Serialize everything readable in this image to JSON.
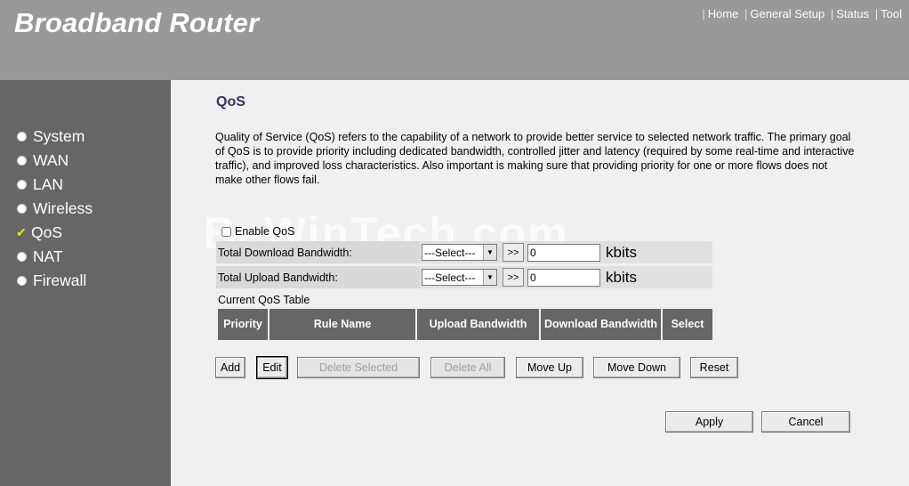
{
  "header": {
    "brand": "Broadband Router",
    "nav": [
      {
        "label": "Home"
      },
      {
        "label": "General Setup"
      },
      {
        "label": "Status"
      },
      {
        "label": "Tool"
      }
    ]
  },
  "sidebar": {
    "items": [
      {
        "label": "System",
        "active": false
      },
      {
        "label": "WAN",
        "active": false
      },
      {
        "label": "LAN",
        "active": false
      },
      {
        "label": "Wireless",
        "active": false
      },
      {
        "label": "QoS",
        "active": true
      },
      {
        "label": "NAT",
        "active": false
      },
      {
        "label": "Firewall",
        "active": false
      }
    ]
  },
  "page": {
    "title": "QoS",
    "description": "Quality of Service (QoS) refers to the capability of a network to provide better service to selected network traffic. The primary goal of QoS is to provide priority including dedicated bandwidth, controlled jitter and latency (required by some real-time and interactive traffic), and improved loss characteristics. Also important is making sure that providing priority for one or more flows does not make other flows fail.",
    "watermark": "BeWinTech.com"
  },
  "form": {
    "enable_label": "Enable QoS",
    "enable_checked": false,
    "download": {
      "label": "Total Download Bandwidth:",
      "select_value": "---Select---",
      "arrow_label": ">>",
      "value": "0",
      "unit": "kbits"
    },
    "upload": {
      "label": "Total Upload Bandwidth:",
      "select_value": "---Select---",
      "arrow_label": ">>",
      "value": "0",
      "unit": "kbits"
    }
  },
  "table": {
    "caption": "Current QoS Table",
    "headers": [
      "Priority",
      "Rule Name",
      "Upload Bandwidth",
      "Download Bandwidth",
      "Select"
    ]
  },
  "buttons": {
    "add": "Add",
    "edit": "Edit",
    "delete_selected": "Delete Selected",
    "delete_all": "Delete All",
    "move_up": "Move Up",
    "move_down": "Move Down",
    "reset": "Reset",
    "apply": "Apply",
    "cancel": "Cancel"
  },
  "colors": {
    "header_bg": "#999999",
    "sidebar_bg": "#666666",
    "title": "#333366",
    "table_header": "#666666"
  }
}
